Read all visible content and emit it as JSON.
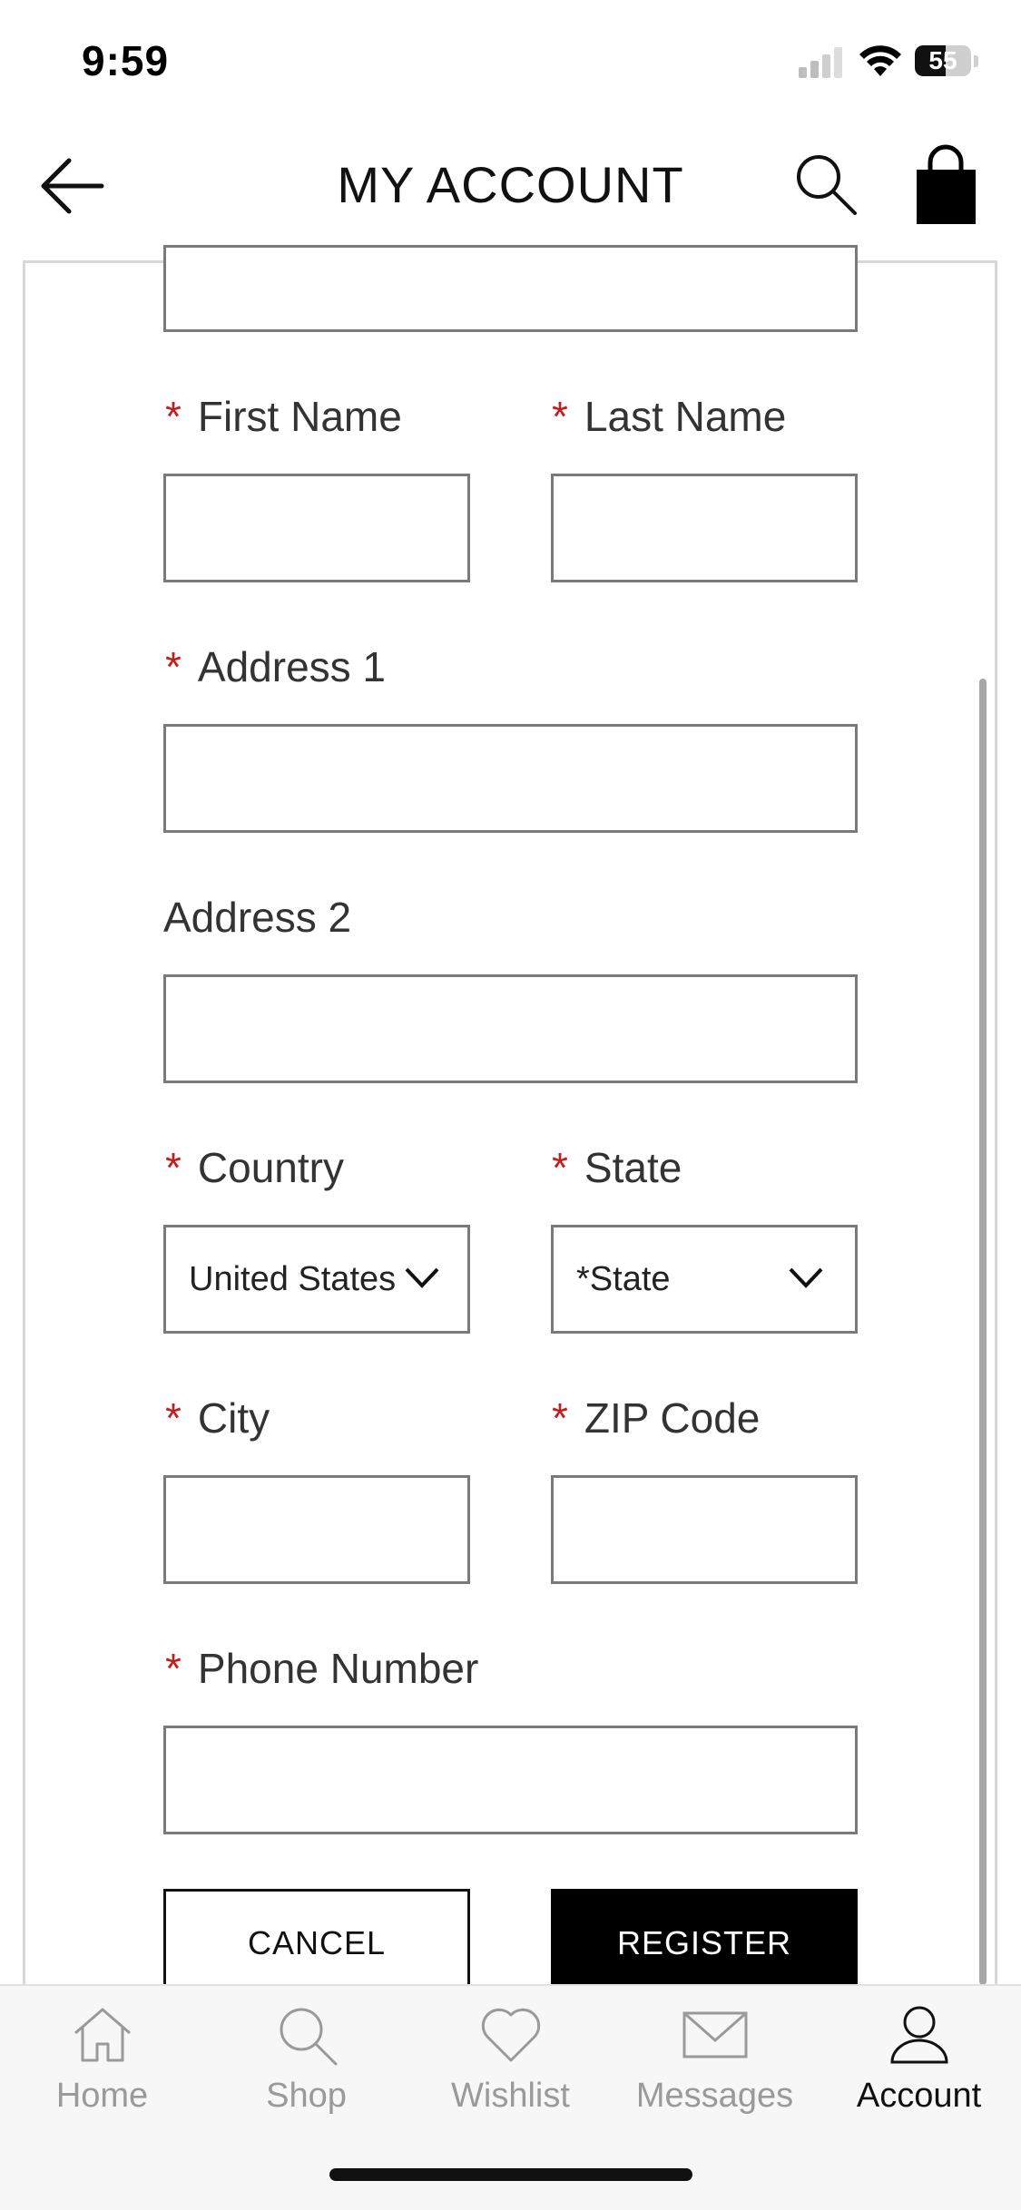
{
  "status_bar": {
    "time": "9:59",
    "battery_level": "55"
  },
  "header": {
    "title": "MY ACCOUNT"
  },
  "form": {
    "required_marker": "*",
    "first_name_label": "First Name",
    "last_name_label": "Last Name",
    "address1_label": "Address 1",
    "address2_label": "Address 2",
    "country_label": "Country",
    "country_value": "United States",
    "state_label": "State",
    "state_value": "*State",
    "city_label": "City",
    "zip_label": "ZIP Code",
    "phone_label": "Phone Number",
    "cancel_label": "CANCEL",
    "register_label": "REGISTER"
  },
  "tab_bar": {
    "items": [
      {
        "label": "Home",
        "icon": "home-icon"
      },
      {
        "label": "Shop",
        "icon": "search-icon"
      },
      {
        "label": "Wishlist",
        "icon": "heart-icon"
      },
      {
        "label": "Messages",
        "icon": "envelope-icon"
      },
      {
        "label": "Account",
        "icon": "person-icon",
        "active": true
      }
    ]
  },
  "colors": {
    "required": "#c21e1e",
    "register_bg": "#000000",
    "tab_inactive": "#9a9a9a"
  }
}
